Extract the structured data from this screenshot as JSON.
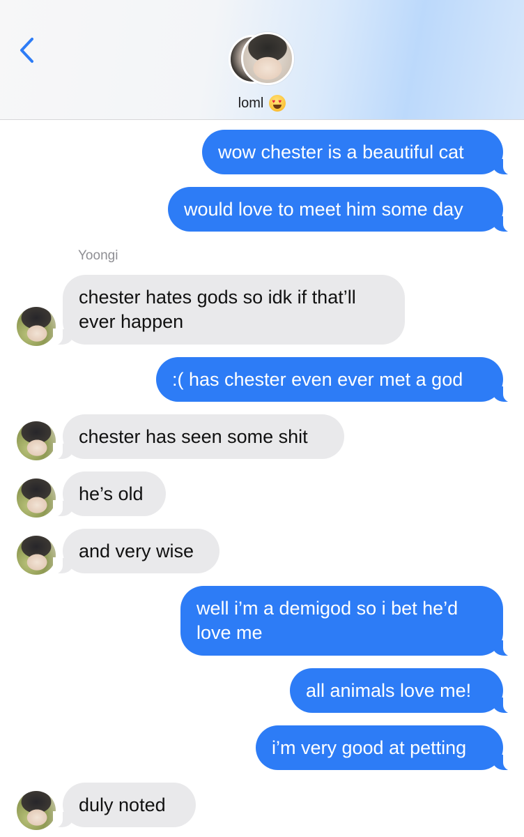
{
  "header": {
    "back_icon": "chevron-left-icon",
    "contact_name": "loml",
    "contact_emoji": "heart-eyes-emoji",
    "accent_color": "#2d7cf6"
  },
  "sender_label": "Yoongi",
  "messages": [
    {
      "from": "me",
      "text": "wow chester is a beautiful cat"
    },
    {
      "from": "me",
      "text": "would love to meet him some day"
    },
    {
      "from": "them",
      "text": "chester hates gods so idk if that’ll ever happen"
    },
    {
      "from": "me",
      "text": ":( has chester even ever met a god"
    },
    {
      "from": "them",
      "text": "chester has seen some shit"
    },
    {
      "from": "them",
      "text": "he’s old"
    },
    {
      "from": "them",
      "text": "and very wise"
    },
    {
      "from": "me",
      "text": "well i’m a demigod so i bet he’d love me"
    },
    {
      "from": "me",
      "text": "all animals love me!"
    },
    {
      "from": "me",
      "text": "i’m very good at petting"
    },
    {
      "from": "them",
      "text": "duly noted"
    }
  ],
  "colors": {
    "sent_bubble": "#2d7cf6",
    "received_bubble": "#e9e9eb",
    "label_gray": "#8e8e93"
  }
}
